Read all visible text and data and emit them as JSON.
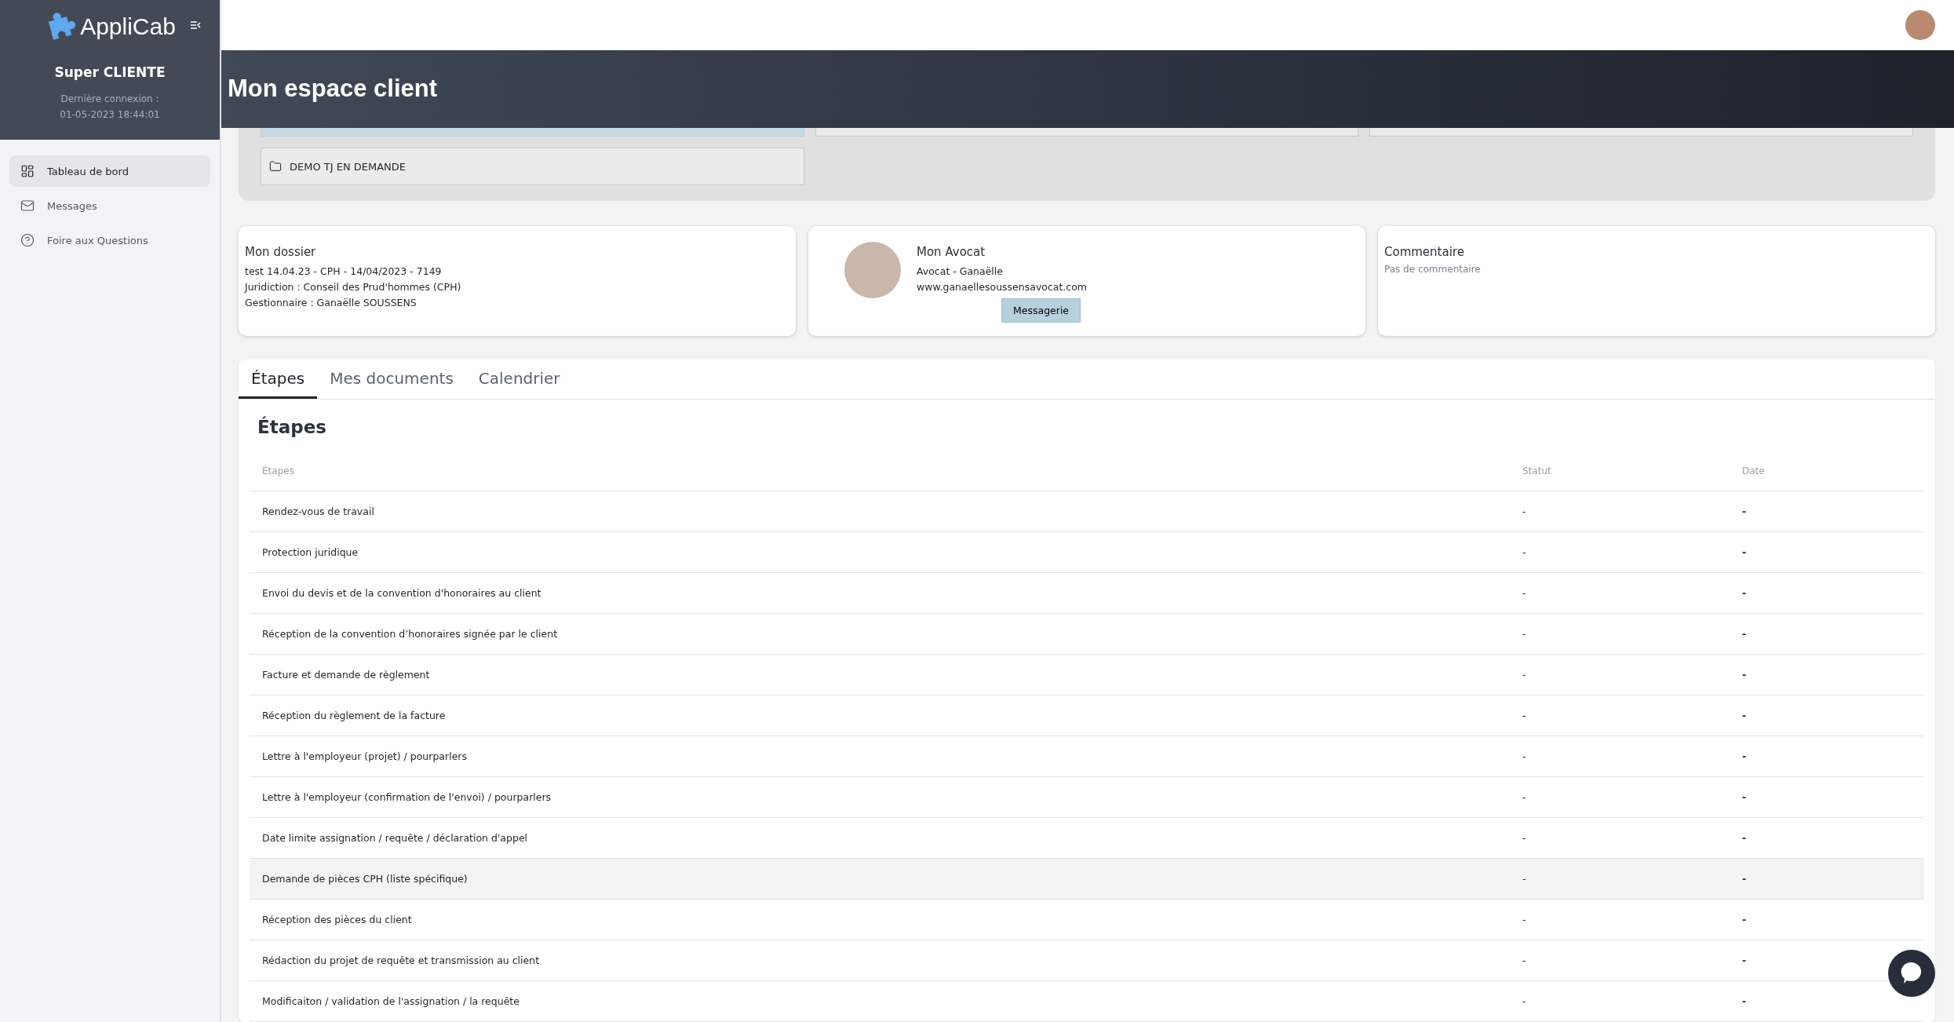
{
  "sidebar": {
    "logo": "AppliCab",
    "user": "Super CLIENTE",
    "last_login_label": "Dernière connexion :",
    "last_login": "01-05-2023 18:44:01",
    "items": [
      {
        "kind": "dashboard",
        "label": "Tableau de bord",
        "selected": true
      },
      {
        "kind": "messages",
        "label": "Messages",
        "selected": false
      },
      {
        "kind": "faq",
        "label": "Foire aux Questions",
        "selected": false
      }
    ]
  },
  "header": {
    "title": "Mon espace client"
  },
  "folders": [
    {
      "selected": true
    },
    {
      "selected": false
    },
    {
      "selected": false
    },
    {
      "label": "DEMO TJ EN DEMANDE",
      "selected": false
    }
  ],
  "dossier": {
    "title": "Mon dossier",
    "lines": [
      "test 14.04.23 - CPH - 14/04/2023 - 7149",
      "Juridiction : Conseil des Prud'hommes (CPH)",
      "Gestionnaire : Ganaëlle SOUSSENS"
    ]
  },
  "avocat": {
    "title": "Mon Avocat",
    "lines": [
      "Avocat - Ganaëlle",
      "www.ganaellesoussensavocat.com"
    ],
    "button": "Messagerie"
  },
  "commentaire": {
    "title": "Commentaire",
    "text": "Pas de commentaire"
  },
  "tabs": [
    {
      "label": "Étapes",
      "selected": true
    },
    {
      "label": "Mes documents",
      "selected": false
    },
    {
      "label": "Calendrier",
      "selected": false
    }
  ],
  "table": {
    "title": "Étapes",
    "columns": [
      "Étapes",
      "Statut",
      "Date"
    ],
    "rows": [
      {
        "cells": [
          "Rendez-vous de travail",
          "-",
          "-"
        ],
        "highlighted": false
      },
      {
        "cells": [
          "Protection juridique",
          "-",
          "-"
        ],
        "highlighted": false
      },
      {
        "cells": [
          "Envoi du devis et de la convention d'honoraires au client",
          "-",
          "-"
        ],
        "highlighted": false
      },
      {
        "cells": [
          "Réception de la convention d’honoraires signée par le client",
          "-",
          "-"
        ],
        "highlighted": false
      },
      {
        "cells": [
          "Facture et demande de règlement",
          "-",
          "-"
        ],
        "highlighted": false
      },
      {
        "cells": [
          "Réception du règlement de la facture",
          "-",
          "-"
        ],
        "highlighted": false
      },
      {
        "cells": [
          "Lettre à l'employeur (projet) / pourparlers",
          "-",
          "-"
        ],
        "highlighted": false
      },
      {
        "cells": [
          "Lettre à l'employeur (confirmation de l'envoi) / pourparlers",
          "-",
          "-"
        ],
        "highlighted": false
      },
      {
        "cells": [
          "Date limite assignation / requête / déclaration d'appel",
          "-",
          "-"
        ],
        "highlighted": false
      },
      {
        "cells": [
          "Demande de pièces CPH (liste spécifique)",
          "-",
          "-"
        ],
        "highlighted": true
      },
      {
        "cells": [
          "Réception des pièces du client",
          "-",
          "-"
        ],
        "highlighted": false
      },
      {
        "cells": [
          "Rédaction du projet de requête et transmission au client",
          "-",
          "-"
        ],
        "highlighted": false
      },
      {
        "cells": [
          "Modificaiton / validation de l'assignation / la requête",
          "-",
          "-"
        ],
        "highlighted": false
      }
    ]
  }
}
